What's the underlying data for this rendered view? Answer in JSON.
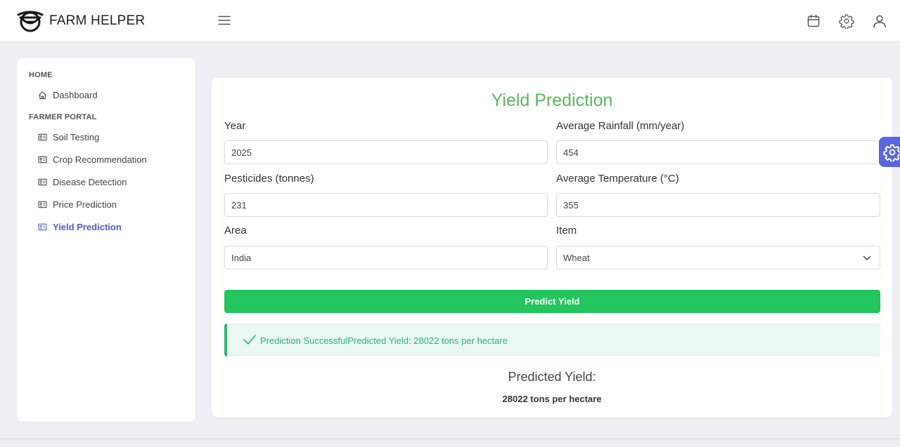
{
  "header": {
    "brand": "FARM HELPER",
    "icons": [
      "menu-icon",
      "calendar-icon",
      "gear-icon",
      "user-icon"
    ]
  },
  "sidebar": {
    "sections": [
      {
        "heading": "HOME",
        "items": [
          {
            "label": "Dashboard",
            "icon": "home-icon"
          }
        ]
      },
      {
        "heading": "FARMER PORTAL",
        "items": [
          {
            "label": "Soil Testing",
            "icon": "id-card-icon"
          },
          {
            "label": "Crop Recommendation",
            "icon": "id-card-icon"
          },
          {
            "label": "Disease Detection",
            "icon": "id-card-icon"
          },
          {
            "label": "Price Prediction",
            "icon": "id-card-icon"
          },
          {
            "label": "Yield Prediction",
            "icon": "id-card-icon",
            "active": true
          }
        ]
      }
    ]
  },
  "form": {
    "title": "Yield Prediction",
    "year": {
      "label": "Year",
      "value": "2025"
    },
    "rainfall": {
      "label": "Average Rainfall (mm/year)",
      "value": "454"
    },
    "pesticides": {
      "label": "Pesticides (tonnes)",
      "value": "231"
    },
    "temperature": {
      "label": "Average Temperature (°C)",
      "value": "355"
    },
    "area": {
      "label": "Area",
      "value": "India"
    },
    "item": {
      "label": "Item",
      "value": "Wheat"
    },
    "submit_label": "Predict Yield"
  },
  "alert": {
    "text": "Prediction SuccessfulPredicted Yield: 28022 tons per hectare",
    "color": "#2fb376"
  },
  "result": {
    "heading": "Predicted Yield:",
    "value": "28022 tons per hectare"
  },
  "colors": {
    "accent": "#4f5bd5",
    "title_green": "#5cb85c",
    "button_green": "#22c55e",
    "settings_tab": "#5b65e0"
  }
}
